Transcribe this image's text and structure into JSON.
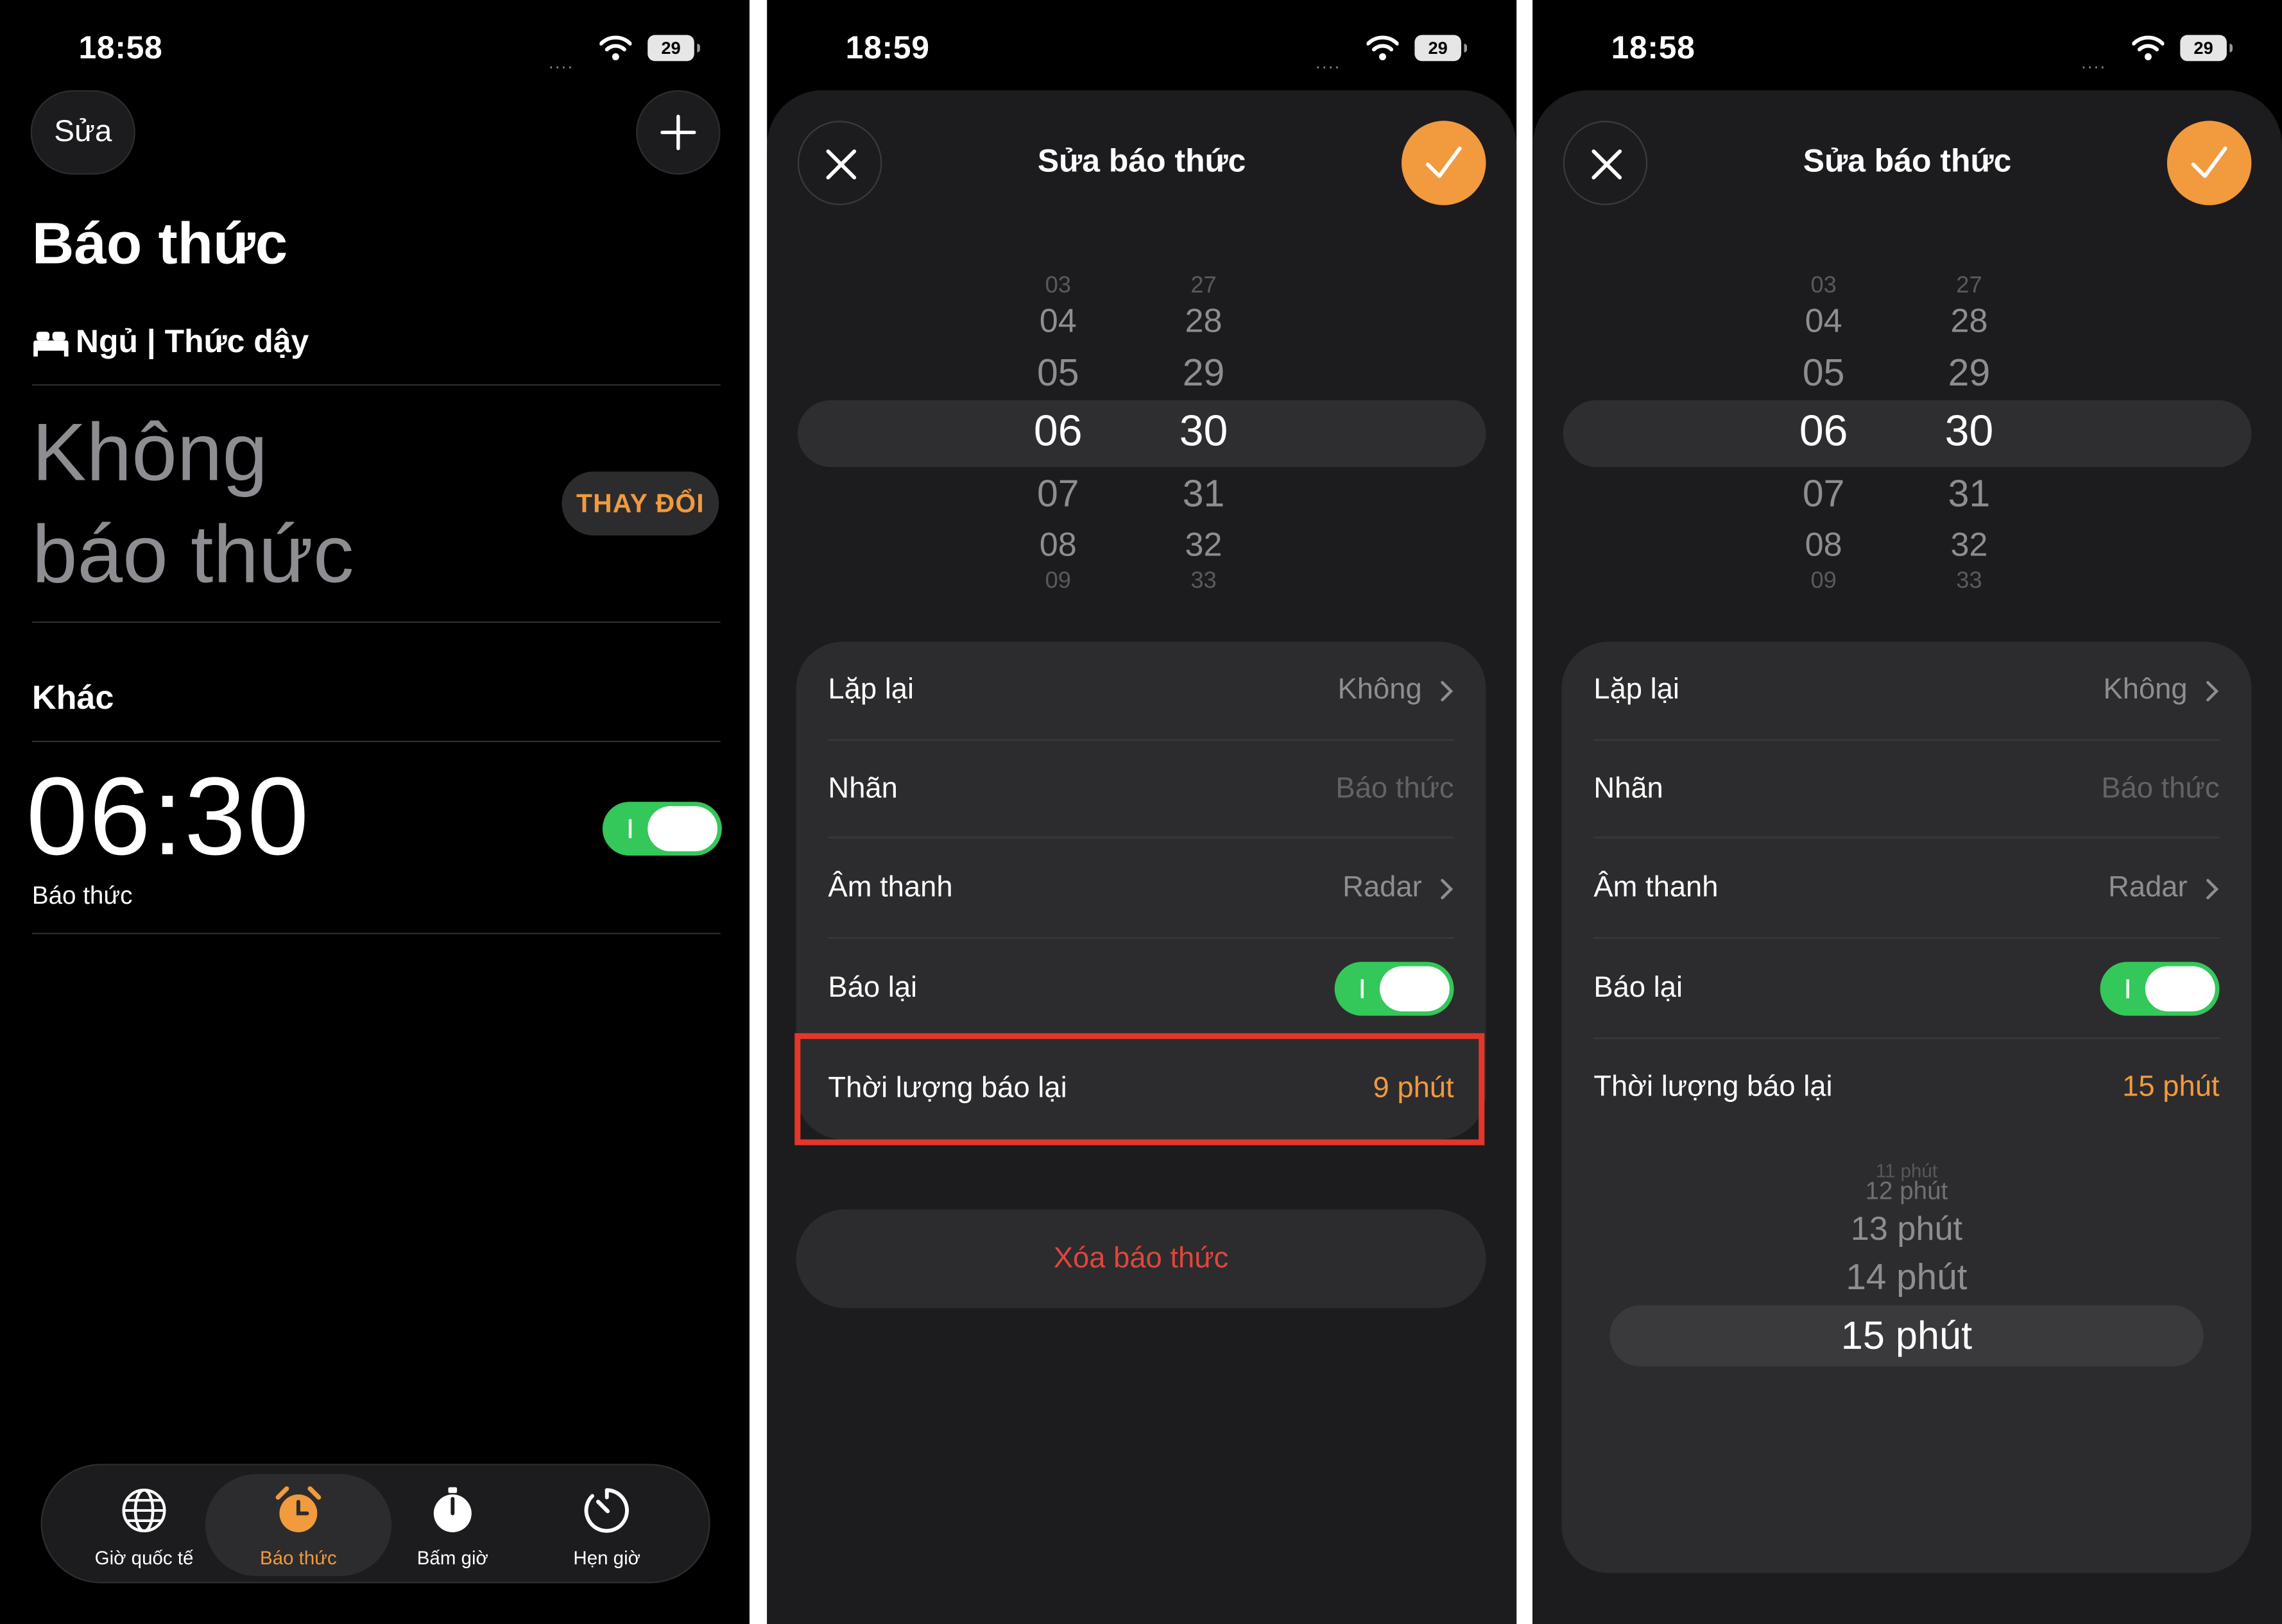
{
  "status": {
    "s1_time": "18:58",
    "s2_time": "18:59",
    "s3_time": "18:58",
    "dots": "....",
    "battery": "29"
  },
  "screen1": {
    "edit_label": "Sửa",
    "title": "Báo thức",
    "sleep_label": "Ngủ | Thức dậy",
    "no_alarm_line1": "Không",
    "no_alarm_line2": "báo thức",
    "change_label": "THAY ĐỔI",
    "other_section": "Khác",
    "alarm_time": "06:30",
    "alarm_label": "Báo thức",
    "alarm_on": true,
    "tabs": [
      {
        "label": "Giờ quốc tế",
        "icon": "globe-icon",
        "active": false
      },
      {
        "label": "Báo thức",
        "icon": "alarm-clock-icon",
        "active": true
      },
      {
        "label": "Bấm giờ",
        "icon": "stopwatch-icon",
        "active": false
      },
      {
        "label": "Hẹn giờ",
        "icon": "timer-icon",
        "active": false
      }
    ]
  },
  "sheet": {
    "title": "Sửa báo thức",
    "hours": [
      "03",
      "04",
      "05",
      "06",
      "07",
      "08",
      "09"
    ],
    "minutes": [
      "27",
      "28",
      "29",
      "30",
      "31",
      "32",
      "33"
    ],
    "selected_hour": "06",
    "selected_minute": "30",
    "rows": {
      "repeat_label": "Lặp lại",
      "repeat_value": "Không",
      "label_label": "Nhãn",
      "label_placeholder": "Báo thức",
      "sound_label": "Âm thanh",
      "sound_value": "Radar",
      "snooze_label": "Báo lại",
      "snooze_duration_label": "Thời lượng báo lại"
    },
    "delete_label": "Xóa báo thức"
  },
  "screen2": {
    "snooze_duration": "9 phút"
  },
  "screen3": {
    "snooze_duration": "15 phút",
    "picker": [
      "11 phút",
      "12 phút",
      "13 phút",
      "14 phút",
      "15 phút"
    ]
  },
  "colors": {
    "accent": "#f19a3e",
    "toggle_on": "#34c759",
    "destructive": "#e0463c",
    "highlight_box": "#e2372a",
    "sheet_bg": "#1c1c1e",
    "card_bg": "#2c2c2e"
  }
}
